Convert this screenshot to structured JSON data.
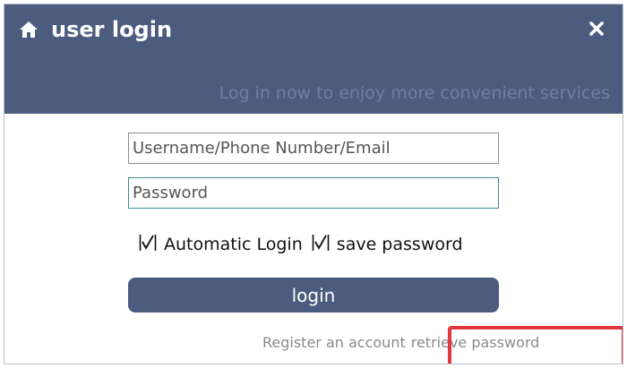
{
  "dialog": {
    "title": "user login",
    "subtitle": "Log in now to enjoy more convenient services",
    "icons": {
      "home": "home-icon",
      "close": "close-icon"
    }
  },
  "form": {
    "username_placeholder": "Username/Phone Number/Email",
    "username_value": "",
    "password_placeholder": "Password",
    "password_value": "",
    "automatic_login_label": "Automatic Login",
    "automatic_login_checked": true,
    "save_password_label": "save password",
    "save_password_checked": true,
    "login_label": "login"
  },
  "links": {
    "register": "Register an account",
    "retrieve": "retrieve password"
  },
  "colors": {
    "header": "#4c5c7f",
    "subtitle": "#6d7ea3",
    "highlight": "#e0383d"
  }
}
